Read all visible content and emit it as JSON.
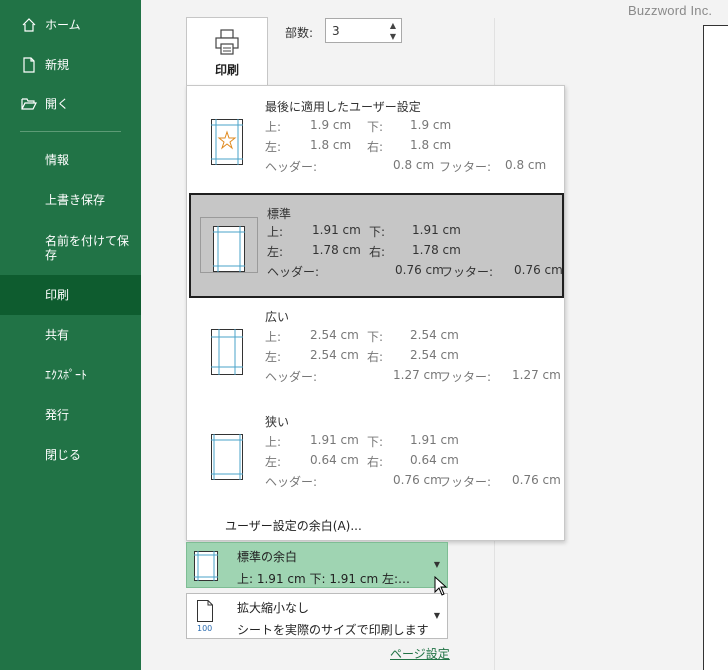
{
  "watermark": "Buzzword Inc.",
  "nav": {
    "home": "ホーム",
    "new": "新規",
    "open": "開く",
    "info": "情報",
    "save": "上書き保存",
    "save_as": "名前を付けて保存",
    "print": "印刷",
    "share": "共有",
    "export": "ｴｸｽﾎﾟｰﾄ",
    "publish": "発行",
    "close": "閉じる"
  },
  "print": {
    "button_label": "印刷",
    "copies_label": "部数:",
    "copies_value": "3"
  },
  "margins_menu": {
    "options": [
      {
        "title": "最後に適用したユーザー設定",
        "top_key": "上:",
        "top": "1.9 cm",
        "bottom_key": "下:",
        "bottom": "1.9 cm",
        "left_key": "左:",
        "left": "1.8 cm",
        "right_key": "右:",
        "right": "1.8 cm",
        "header_key": "ヘッダー:",
        "header": "0.8 cm",
        "footer_key": "フッター:",
        "footer": "0.8 cm"
      },
      {
        "title": "標準",
        "top_key": "上:",
        "top": "1.91 cm",
        "bottom_key": "下:",
        "bottom": "1.91 cm",
        "left_key": "左:",
        "left": "1.78 cm",
        "right_key": "右:",
        "right": "1.78 cm",
        "header_key": "ヘッダー:",
        "header": "0.76 cm",
        "footer_key": "フッター:",
        "footer": "0.76 cm"
      },
      {
        "title": "広い",
        "top_key": "上:",
        "top": "2.54 cm",
        "bottom_key": "下:",
        "bottom": "2.54 cm",
        "left_key": "左:",
        "left": "2.54 cm",
        "right_key": "右:",
        "right": "2.54 cm",
        "header_key": "ヘッダー:",
        "header": "1.27 cm",
        "footer_key": "フッター:",
        "footer": "1.27 cm"
      },
      {
        "title": "狭い",
        "top_key": "上:",
        "top": "1.91 cm",
        "bottom_key": "下:",
        "bottom": "1.91 cm",
        "left_key": "左:",
        "left": "0.64 cm",
        "right_key": "右:",
        "right": "0.64 cm",
        "header_key": "ヘッダー:",
        "header": "0.76 cm",
        "footer_key": "フッター:",
        "footer": "0.76 cm"
      }
    ],
    "custom": "ユーザー設定の余白(A)..."
  },
  "margins_select": {
    "line1": "標準の余白",
    "line2": "上: 1.91 cm 下: 1.91 cm 左:…"
  },
  "scaling_select": {
    "line1": "拡大縮小なし",
    "line2": "シートを実際のサイズで印刷します",
    "icon_number": "100"
  },
  "page_setup_link": "ページ設定",
  "colors": {
    "nav_bg": "#217346",
    "nav_active": "#0e5c2f",
    "selected_option": "#c6c6c6",
    "margins_select_bg": "#9fd4b2"
  }
}
